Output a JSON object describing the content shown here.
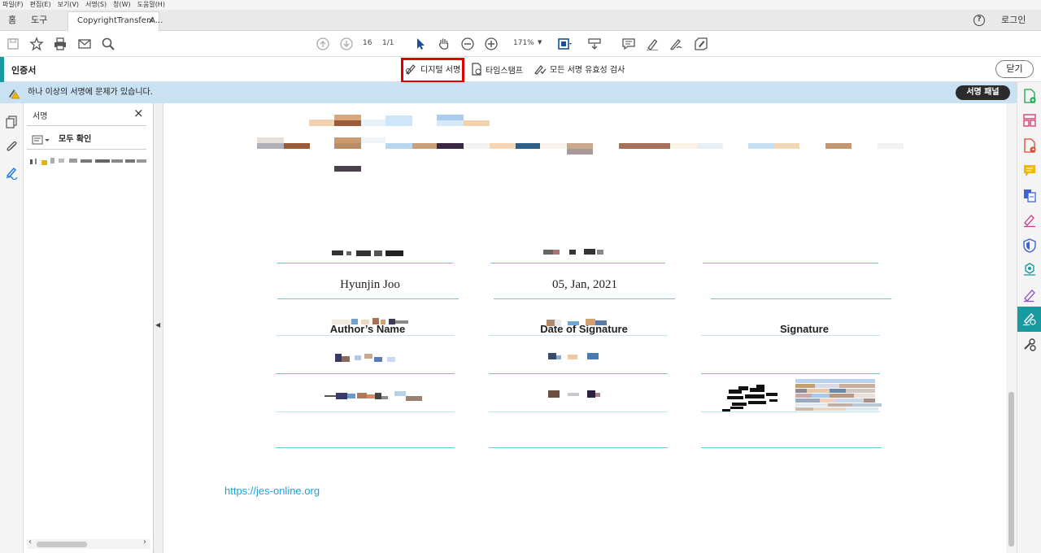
{
  "menu": [
    "파일(F)",
    "편집(E)",
    "보기(V)",
    "서명(S)",
    "창(W)",
    "도움말(H)"
  ],
  "tabs": {
    "home": "홈",
    "tools": "도구",
    "document": "CopyrightTransferA...",
    "close": "×"
  },
  "account": {
    "help": "?",
    "login": "로그인"
  },
  "toolbar": {
    "page_current": "16",
    "page_total": "1/1",
    "zoom": "171%"
  },
  "certificates": {
    "title": "인증서",
    "digital_sign": "디지털 서명",
    "timestamp": "타임스탬프",
    "validate_all": "모든 서명 유효성 검사",
    "close": "닫기"
  },
  "warning": {
    "message": "하나 이상의 서명에 문제가 있습니다.",
    "panel_button": "서명 패널"
  },
  "sig_panel": {
    "title": "서명",
    "close": "×",
    "verify_all": "모두 확인"
  },
  "document": {
    "headers": [
      "Author’s Name",
      "Date of Signature",
      "Signature"
    ],
    "author_name": "Hyunjin Joo",
    "date": "05, Jan, 2021",
    "url": "https://jes-online.org"
  },
  "colors": {
    "accent_teal": "#189aa0",
    "warning_bg": "#c8e1f3",
    "highlight_red": "#e00000",
    "link": "#1aa3d6"
  }
}
